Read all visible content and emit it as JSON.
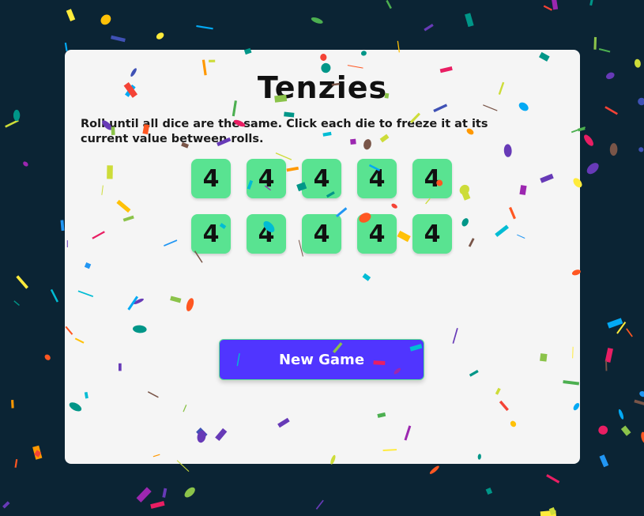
{
  "game": {
    "title": "Tenzies",
    "instructions": "Roll until all dice are the same. Click each die to freeze it at its current value between rolls.",
    "dice": [
      4,
      4,
      4,
      4,
      4,
      4,
      4,
      4,
      4,
      4
    ],
    "button_label": "New Game"
  },
  "colors": {
    "background": "#0b2434",
    "card": "#f5f5f5",
    "die": "#59e391",
    "button": "#5035ff",
    "confetti": [
      "#f44336",
      "#e91e63",
      "#9c27b0",
      "#673ab7",
      "#3f51b5",
      "#2196f3",
      "#03a9f4",
      "#00bcd4",
      "#009688",
      "#4caf50",
      "#8bc34a",
      "#cddc39",
      "#ffeb3b",
      "#ffc107",
      "#ff9800",
      "#ff5722",
      "#795548"
    ]
  },
  "status": {
    "game_won": true,
    "effect": "confetti"
  }
}
